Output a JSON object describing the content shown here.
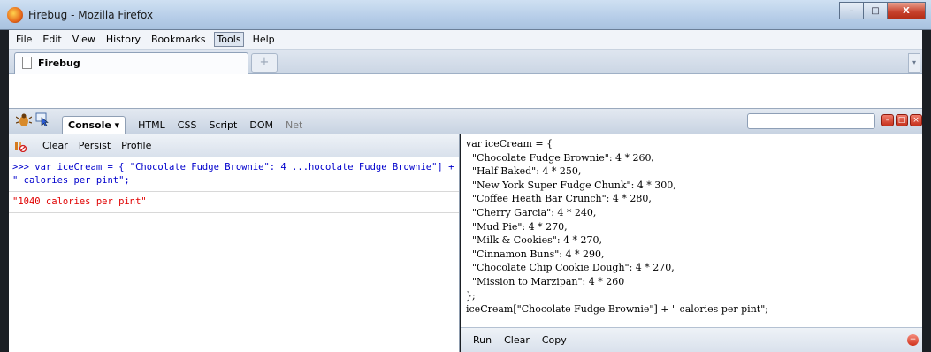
{
  "window": {
    "title": "Firebug - Mozilla Firefox",
    "controls": [
      "–",
      "□",
      "X"
    ]
  },
  "menubar": {
    "items": [
      "File",
      "Edit",
      "View",
      "History",
      "Bookmarks",
      "Tools",
      "Help"
    ],
    "pressed_item": "Tools"
  },
  "tabbar": {
    "tabs": [
      {
        "label": "Firebug"
      }
    ],
    "new_tab": "+",
    "list_all": "▾"
  },
  "firebug": {
    "panel_tabs": {
      "console": "Console ▾",
      "html": "HTML",
      "css": "CSS",
      "script": "Script",
      "dom": "DOM",
      "net": "Net"
    },
    "active_panel": "Console",
    "search": {
      "value": ""
    },
    "window_buttons": [
      "–",
      "□",
      "×"
    ]
  },
  "console": {
    "toolbar": {
      "clear": "Clear",
      "persist": "Persist",
      "profile": "Profile"
    },
    "log": [
      {
        "type": "command",
        "text": ">>> var iceCream = {   \"Chocolate Fudge Brownie\": 4 ...hocolate Fudge Brownie\"] + \" calories per pint\";"
      },
      {
        "type": "result",
        "text": "\"1040 calories per pint\""
      }
    ]
  },
  "editor": {
    "code": "var iceCream = {\n  \"Chocolate Fudge Brownie\": 4 * 260,\n  \"Half Baked\": 4 * 250,\n  \"New York Super Fudge Chunk\": 4 * 300,\n  \"Coffee Heath Bar Crunch\": 4 * 280,\n  \"Cherry Garcia\": 4 * 240,\n  \"Mud Pie\": 4 * 270,\n  \"Milk & Cookies\": 4 * 270,\n  \"Cinnamon Buns\": 4 * 290,\n  \"Chocolate Chip Cookie Dough\": 4 * 270,\n  \"Mission to Marzipan\": 4 * 260\n};\niceCream[\"Chocolate Fudge Brownie\"] + \" calories per pint\";",
    "footer": {
      "run": "Run",
      "clear": "Clear",
      "copy": "Copy"
    }
  },
  "colors": {
    "command_text": "#0000cc",
    "result_text": "#e00000",
    "close_red": "#c5301b"
  }
}
